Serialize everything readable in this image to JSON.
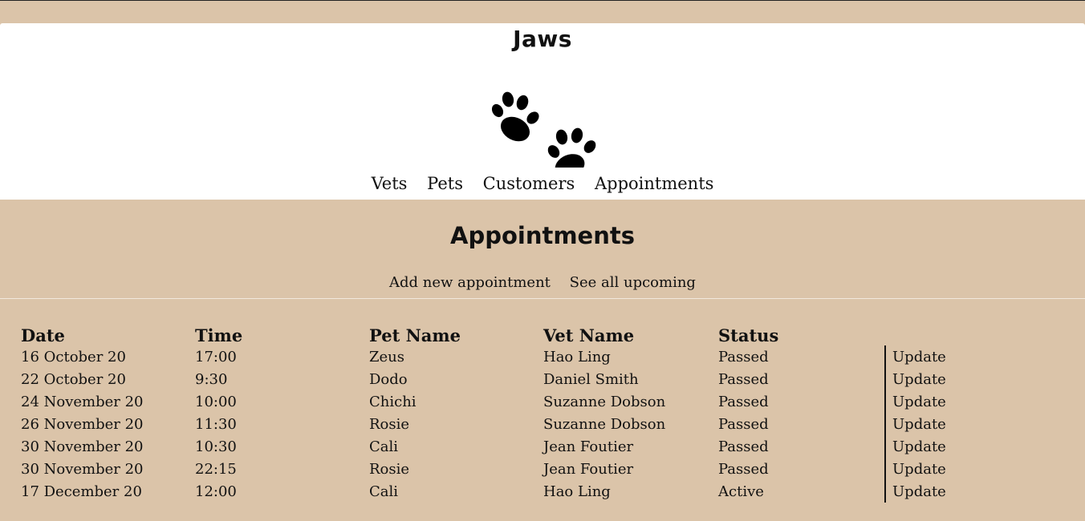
{
  "header": {
    "brand": "Jaws",
    "logo_icon": "paw-prints-icon",
    "nav": [
      "Vets",
      "Pets",
      "Customers",
      "Appointments"
    ]
  },
  "page": {
    "title": "Appointments",
    "actions": [
      "Add new appointment",
      "See all upcoming"
    ]
  },
  "table": {
    "columns": [
      "Date",
      "Time",
      "Pet Name",
      "Vet Name",
      "Status",
      ""
    ],
    "rows": [
      {
        "date": "16 October 20",
        "time": "17:00",
        "pet": "Zeus",
        "vet": "Hao Ling",
        "status": "Passed",
        "action": "Update"
      },
      {
        "date": "22 October 20",
        "time": "9:30",
        "pet": "Dodo",
        "vet": "Daniel Smith",
        "status": "Passed",
        "action": "Update"
      },
      {
        "date": "24 November 20",
        "time": "10:00",
        "pet": "Chichi",
        "vet": "Suzanne Dobson",
        "status": "Passed",
        "action": "Update"
      },
      {
        "date": "26 November 20",
        "time": "11:30",
        "pet": "Rosie",
        "vet": "Suzanne Dobson",
        "status": "Passed",
        "action": "Update"
      },
      {
        "date": "30 November 20",
        "time": "10:30",
        "pet": "Cali",
        "vet": "Jean Foutier",
        "status": "Passed",
        "action": "Update"
      },
      {
        "date": "30 November 20",
        "time": "22:15",
        "pet": "Rosie",
        "vet": "Jean Foutier",
        "status": "Passed",
        "action": "Update"
      },
      {
        "date": "17 December 20",
        "time": "12:00",
        "pet": "Cali",
        "vet": "Hao Ling",
        "status": "Active",
        "action": "Update"
      }
    ]
  },
  "colors": {
    "background": "#dbc4a9",
    "header_background": "#ffffff",
    "text": "#111111"
  }
}
